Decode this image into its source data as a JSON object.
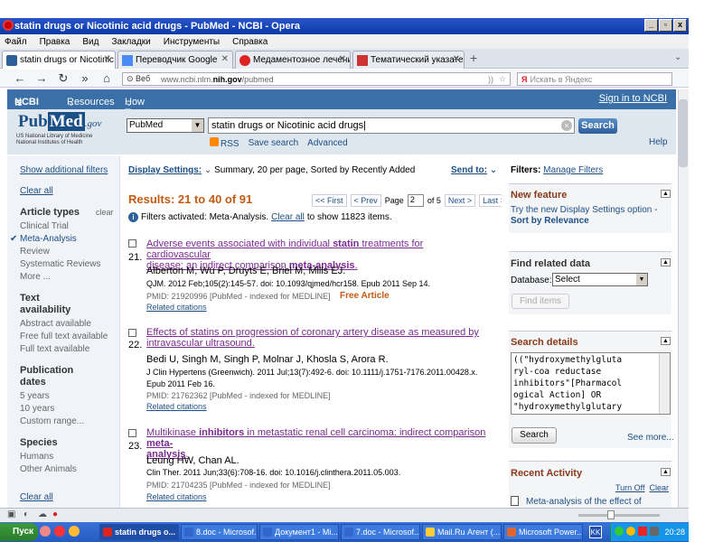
{
  "window": {
    "title": "statin drugs or Nicotinic acid drugs - PubMed - NCBI - Opera"
  },
  "menu": [
    "Файл",
    "Правка",
    "Вид",
    "Закладки",
    "Инструменты",
    "Справка"
  ],
  "tabs": [
    {
      "label": "statin drugs or Nicotinic ac..."
    },
    {
      "label": "Переводчик Google"
    },
    {
      "label": "Медаментозное лечени..."
    },
    {
      "label": "Тематический указате..."
    }
  ],
  "nav": {
    "web_label": "Веб",
    "url_prefix": "www.ncbi.nlm.",
    "url_host": "nih.gov",
    "url_path": "/pubmed",
    "search_placeholder": "Искать в Яндекс"
  },
  "ncbi": {
    "logo": "NCBI",
    "resources": "Resources",
    "howto": "How To",
    "signin": "Sign in to NCBI"
  },
  "pubmed": {
    "logo_a": "Pub",
    "logo_b": "Med",
    "logo_gov": ".gov",
    "sub1": "US National Library of Medicine",
    "sub2": "National Institutes of Health",
    "db": "PubMed",
    "query": "statin drugs or Nicotinic acid drugs",
    "search_btn": "Search",
    "rss": "RSS",
    "save_search": "Save search",
    "advanced": "Advanced",
    "help": "Help"
  },
  "left": {
    "show_filters": "Show additional filters",
    "clear_all": "Clear all",
    "article_types": "Article types",
    "clear": "clear",
    "types": [
      "Clinical Trial",
      "Meta-Analysis",
      "Review",
      "Systematic Reviews",
      "More ..."
    ],
    "text_avail_1": "Text",
    "text_avail_2": "availability",
    "avail": [
      "Abstract available",
      "Free full text available",
      "Full text available"
    ],
    "pubdates_1": "Publication",
    "pubdates_2": "dates",
    "dates": [
      "5 years",
      "10 years",
      "Custom range..."
    ],
    "species": "Species",
    "species_items": [
      "Humans",
      "Other Animals"
    ],
    "clear_all_bottom": "Clear all"
  },
  "main": {
    "display_settings": "Display Settings:",
    "display_summary": "Summary, 20 per page, Sorted by Recently Added",
    "send_to": "Send to:",
    "results": "Results: 21 to 40 of 91",
    "pager": {
      "first": "<< First",
      "prev": "< Prev",
      "page_label": "Page",
      "page": "2",
      "of": "of 5",
      "next": "Next >",
      "last": "Last >>"
    },
    "filter_note": "Filters activated: Meta-Analysis.",
    "filter_clear": "Clear all",
    "filter_rest": "to show 11823 items.",
    "items": [
      {
        "num": "21.",
        "title_a": "Adverse events associated with individual ",
        "title_b": "statin",
        "title_c": " treatments for cardiovascular",
        "title_d": "disease: an indirect comparison ",
        "title_e": "meta-analysis",
        "title_f": ".",
        "authors": "Alberton M, Wu P, Druyts E, Briel M, Mills EJ.",
        "journal": "QJM. 2012 Feb;105(2):145-57. doi: 10.1093/qjmed/hcr158. Epub 2011 Sep 14.",
        "pmid": "PMID: 21920996 [PubMed - indexed for MEDLINE]",
        "free": "Free Article",
        "related": "Related citations"
      },
      {
        "num": "22.",
        "title_a": "Effects of statins on progression of coronary artery disease as measured by",
        "title_d": "intravascular ultrasound.",
        "authors": "Bedi U, Singh M, Singh P, Molnar J, Khosla S, Arora R.",
        "journal": "J Clin Hypertens (Greenwich). 2011 Jul;13(7):492-6. doi: 10.1111/j.1751-7176.2011.00428.x.",
        "journal2": "Epub 2011 Feb 16.",
        "pmid": "PMID: 21762362 [PubMed - indexed for MEDLINE]",
        "related": "Related citations"
      },
      {
        "num": "23.",
        "title_a": "Multikinase ",
        "title_b": "inhibitors",
        "title_c": " in metastatic renal cell carcinoma: indirect comparison ",
        "title_e": "meta-",
        "title_d2": "analysis",
        "title_f": ".",
        "authors": "Leung HW, Chan AL.",
        "journal": "Clin Ther. 2011 Jun;33(6):708-16. doi: 10.1016/j.clinthera.2011.05.003.",
        "pmid": "PMID: 21704235 [PubMed - indexed for MEDLINE]",
        "related": "Related citations"
      }
    ]
  },
  "right": {
    "filters_label": "Filters:",
    "manage": "Manage Filters",
    "new_feature": "New feature",
    "nf_text1": "Try the new Display Settings option -",
    "nf_text2": "Sort by Relevance",
    "find_related": "Find related data",
    "database": "Database:",
    "db_select": "Select",
    "find_items": "Find items",
    "search_details": "Search details",
    "details_lines": [
      "((\"hydroxymethylgluta",
      "ryl-coa reductase",
      "inhibitors\"[Pharmacol",
      "ogical Action] OR",
      "\"hydroxymethylglutary"
    ],
    "search_btn": "Search",
    "see_more": "See more...",
    "recent": "Recent Activity",
    "turn_off": "Turn Off",
    "clear": "Clear",
    "recent_item": "Meta-analysis of the effect of"
  },
  "taskbar": {
    "start": "Пуск",
    "tasks": [
      "statin drugs o...",
      "8.doc - Microsof...",
      "Документ1 - Mi...",
      "7.doc - Microsof...",
      "Mail.Ru Агент (...",
      "Microsoft Power..."
    ],
    "kk": "KK",
    "time": "20:28"
  }
}
